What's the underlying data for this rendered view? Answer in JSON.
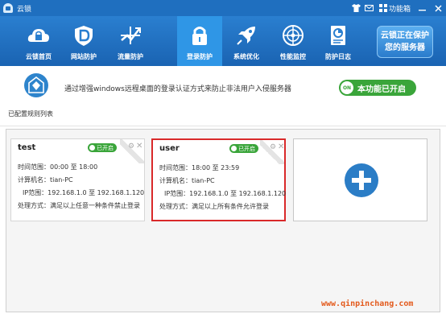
{
  "app": {
    "title": "云锁"
  },
  "titlebar": {
    "menu_label": "功能箱"
  },
  "nav": [
    {
      "label": "云锁首页",
      "icon": "cloud-lock-icon"
    },
    {
      "label": "网站防护",
      "icon": "website-shield-icon"
    },
    {
      "label": "流量防护",
      "icon": "traffic-icon"
    },
    {
      "label": "登录防护",
      "icon": "padlock-icon",
      "active": true
    },
    {
      "label": "系统优化",
      "icon": "rocket-icon"
    },
    {
      "label": "性能监控",
      "icon": "radar-icon"
    },
    {
      "label": "防护日志",
      "icon": "log-icon"
    }
  ],
  "promo": {
    "line1": "云锁正在保护",
    "line2": "您的服务器"
  },
  "info": {
    "icon_label": "已配置规则列表",
    "description": "通过增强windows远程桌面的登录认证方式来防止非法用户入侵服务器",
    "toggle_label": "本功能已开启",
    "toggle_knob": "ON"
  },
  "rules": [
    {
      "name": "test",
      "status": "已开启",
      "time_range": "时间范围：00:00 至 18:00",
      "computer_name": "计算机名：tian-PC",
      "ip_range": "IP范围：192.168.1.0 至 192.168.1.120",
      "action": "处理方式：满足以上任意一种条件禁止登录"
    },
    {
      "name": "user",
      "status": "已开启",
      "time_range": "时间范围：18:00 至 23:59",
      "computer_name": "计算机名：tian-PC",
      "ip_range": "IP范围：192.168.1.0 至 192.168.1.120",
      "action": "处理方式：满足以上所有条件允许登录"
    }
  ],
  "watermark": "www.qinpinchang.com",
  "colors": {
    "primary": "#1f6fbf",
    "active_tab": "#2f96e6",
    "on_green": "#3aa53a",
    "selected_border": "#d9292a",
    "watermark": "#e35a1c"
  }
}
